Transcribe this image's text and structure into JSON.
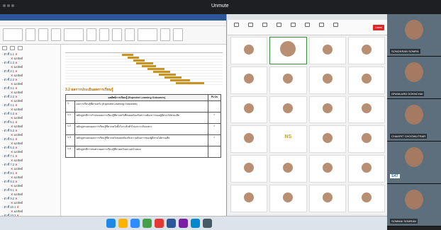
{
  "window": {
    "unmute_label": "Unmute"
  },
  "nav": {
    "items": [
      {
        "label": "- ตัวชี้ 1.1",
        "mark": "✕",
        "sub": false
      },
      {
        "label": "ผลลัพธ์",
        "mark": "✕",
        "sub": true
      },
      {
        "label": "- ตัวชี้ 1.2",
        "mark": "✕",
        "sub": false
      },
      {
        "label": "ผลลัพธ์",
        "mark": "✕",
        "sub": true
      },
      {
        "label": "- ตัวชี้ 2.1",
        "mark": "✕",
        "sub": false
      },
      {
        "label": "ผลลัพธ์",
        "mark": "✕",
        "sub": true
      },
      {
        "label": "- ตัวชี้ 2.2",
        "mark": "✕",
        "sub": false
      },
      {
        "label": "ผลลัพธ์",
        "mark": "✕",
        "sub": true
      },
      {
        "label": "- ตัวชี้ 3.1",
        "mark": "✕",
        "sub": false
      },
      {
        "label": "ผลลัพธ์",
        "mark": "✕",
        "sub": true
      },
      {
        "label": "- ตัวชี้ 3.2",
        "mark": "✕",
        "sub": false
      },
      {
        "label": "ผลลัพธ์",
        "mark": "✕",
        "sub": true
      },
      {
        "label": "- ตัวชี้ 4.1",
        "mark": "✕",
        "sub": false
      },
      {
        "label": "ผลลัพธ์",
        "mark": "✕",
        "sub": true
      },
      {
        "label": "- ตัวชี้ 4.2",
        "mark": "✕",
        "sub": false
      },
      {
        "label": "ผลลัพธ์",
        "mark": "✕",
        "sub": true
      },
      {
        "label": "- ตัวชี้ 5.1",
        "mark": "✕",
        "sub": false
      },
      {
        "label": "ผลลัพธ์",
        "mark": "✕",
        "sub": true
      },
      {
        "label": "- ตัวชี้ 5.2",
        "mark": "✕",
        "sub": false
      },
      {
        "label": "ผลลัพธ์",
        "mark": "✕",
        "sub": true
      },
      {
        "label": "- ตัวชี้ 6.1",
        "mark": "✕",
        "sub": false
      },
      {
        "label": "ผลลัพธ์",
        "mark": "✕",
        "sub": true
      },
      {
        "label": "- ตัวชี้ 6.2",
        "mark": "✕",
        "sub": false
      },
      {
        "label": "ผลลัพธ์",
        "mark": "✕",
        "sub": true
      },
      {
        "label": "- ตัวชี้ 7.1",
        "mark": "✕",
        "sub": false
      },
      {
        "label": "ผลลัพธ์",
        "mark": "✕",
        "sub": true
      },
      {
        "label": "- ตัวชี้ 7.2",
        "mark": "✕",
        "sub": false
      },
      {
        "label": "ผลลัพธ์",
        "mark": "✕",
        "sub": true
      },
      {
        "label": "- ตัวชี้ 8.1",
        "mark": "✕",
        "sub": false
      },
      {
        "label": "ผลลัพธ์",
        "mark": "✕",
        "sub": true
      },
      {
        "label": "- ตัวชี้ 8.2",
        "mark": "✕",
        "sub": false
      },
      {
        "label": "ผลลัพธ์",
        "mark": "✕",
        "sub": true
      },
      {
        "label": "- ตัวชี้ 9.1",
        "mark": "✕",
        "sub": false
      },
      {
        "label": "ผลลัพธ์",
        "mark": "✕",
        "sub": true
      },
      {
        "label": "- ตัวชี้ 9.2",
        "mark": "✕",
        "sub": false
      },
      {
        "label": "ผลลัพธ์",
        "mark": "✕",
        "sub": true
      },
      {
        "label": "- ตัวชี้ 10.1",
        "mark": "✕",
        "sub": false
      },
      {
        "label": "ผลลัพธ์",
        "mark": "✕",
        "sub": true
      },
      {
        "label": "- ตัวชี้ 10.2",
        "mark": "✕",
        "sub": false
      }
    ]
  },
  "document": {
    "section_title": "3.2 ผลการประเมินผลการเรียนรู้",
    "table": {
      "header_col1": "มาตรฐานการเรียนรู้ (Learning)",
      "header_col2": "ผลลัพธ์การเรียนรู้ (Expected Learning Outcomes)",
      "header_col3": "PLOs",
      "rows": [
        {
          "num": "1.",
          "text": "ผลการเรียนรู้ที่คาดหวัง (Expected Learning Outcomes)",
          "check": ""
        },
        {
          "num": "1.1",
          "text": "หลักสูตรมีการกำหนดผลการเรียนรู้ที่คาดหวังที่สอดคล้องกับความต้องการของผู้มีส่วนได้ส่วนเสีย",
          "check": "✓"
        },
        {
          "num": "1.2",
          "text": "หลักสูตรแสดงผลการเรียนรู้ที่คาดหวังทั้งในระดับทั่วไปและระดับเฉพาะ",
          "check": "✓"
        },
        {
          "num": "1.3",
          "text": "หลักสูตรแสดงผลการเรียนรู้ที่คาดหวังสอดคล้องกับความต้องการของผู้มีส่วนได้ส่วนเสีย",
          "check": "✓"
        },
        {
          "num": "1.4",
          "text": "หลักสูตรมีการทบทวนผลการเรียนรู้ที่คาดหวังอย่างสม่ำเสมอ",
          "check": ""
        }
      ]
    }
  },
  "zoom": {
    "leave_label": "Leave",
    "tiles": [
      {
        "name": "",
        "type": "face"
      },
      {
        "name": "",
        "type": "face",
        "active": true
      },
      {
        "name": "",
        "type": "face"
      },
      {
        "name": "",
        "type": "face"
      },
      {
        "name": "",
        "type": "face"
      },
      {
        "name": "",
        "type": "face"
      },
      {
        "name": "",
        "type": "face"
      },
      {
        "name": "",
        "type": "face"
      },
      {
        "name": "",
        "type": "face"
      },
      {
        "name": "",
        "type": "face"
      },
      {
        "name": "",
        "type": "face"
      },
      {
        "name": "",
        "type": "face"
      },
      {
        "name": "",
        "type": "face"
      },
      {
        "name": "",
        "type": "initials",
        "initials": "NS"
      },
      {
        "name": "",
        "type": "face"
      },
      {
        "name": "",
        "type": "face"
      },
      {
        "name": "",
        "type": "face"
      },
      {
        "name": "",
        "type": "face"
      },
      {
        "name": "",
        "type": "face"
      },
      {
        "name": "",
        "type": "face"
      },
      {
        "name": "",
        "type": "face"
      },
      {
        "name": "",
        "type": "face"
      },
      {
        "name": "",
        "type": "face"
      },
      {
        "name": "",
        "type": "face"
      }
    ]
  },
  "speakers": [
    {
      "name": "SONGKRAN SOMRA",
      "tag": ""
    },
    {
      "name": "GRANLARD DOKNCHAI",
      "tag": ""
    },
    {
      "name": "CHAKRIT CHOOWUTRAR",
      "tag": ""
    },
    {
      "name": "",
      "tag": "SAT"
    },
    {
      "name": "SOMMAI SOMRAN",
      "tag": ""
    }
  ],
  "colors": {
    "word_blue": "#2b579a",
    "gantt_bar": "#c8941f",
    "leave_red": "#e02828",
    "delete_mark": "#c0392b",
    "nav_selected": "#cde0f5"
  }
}
